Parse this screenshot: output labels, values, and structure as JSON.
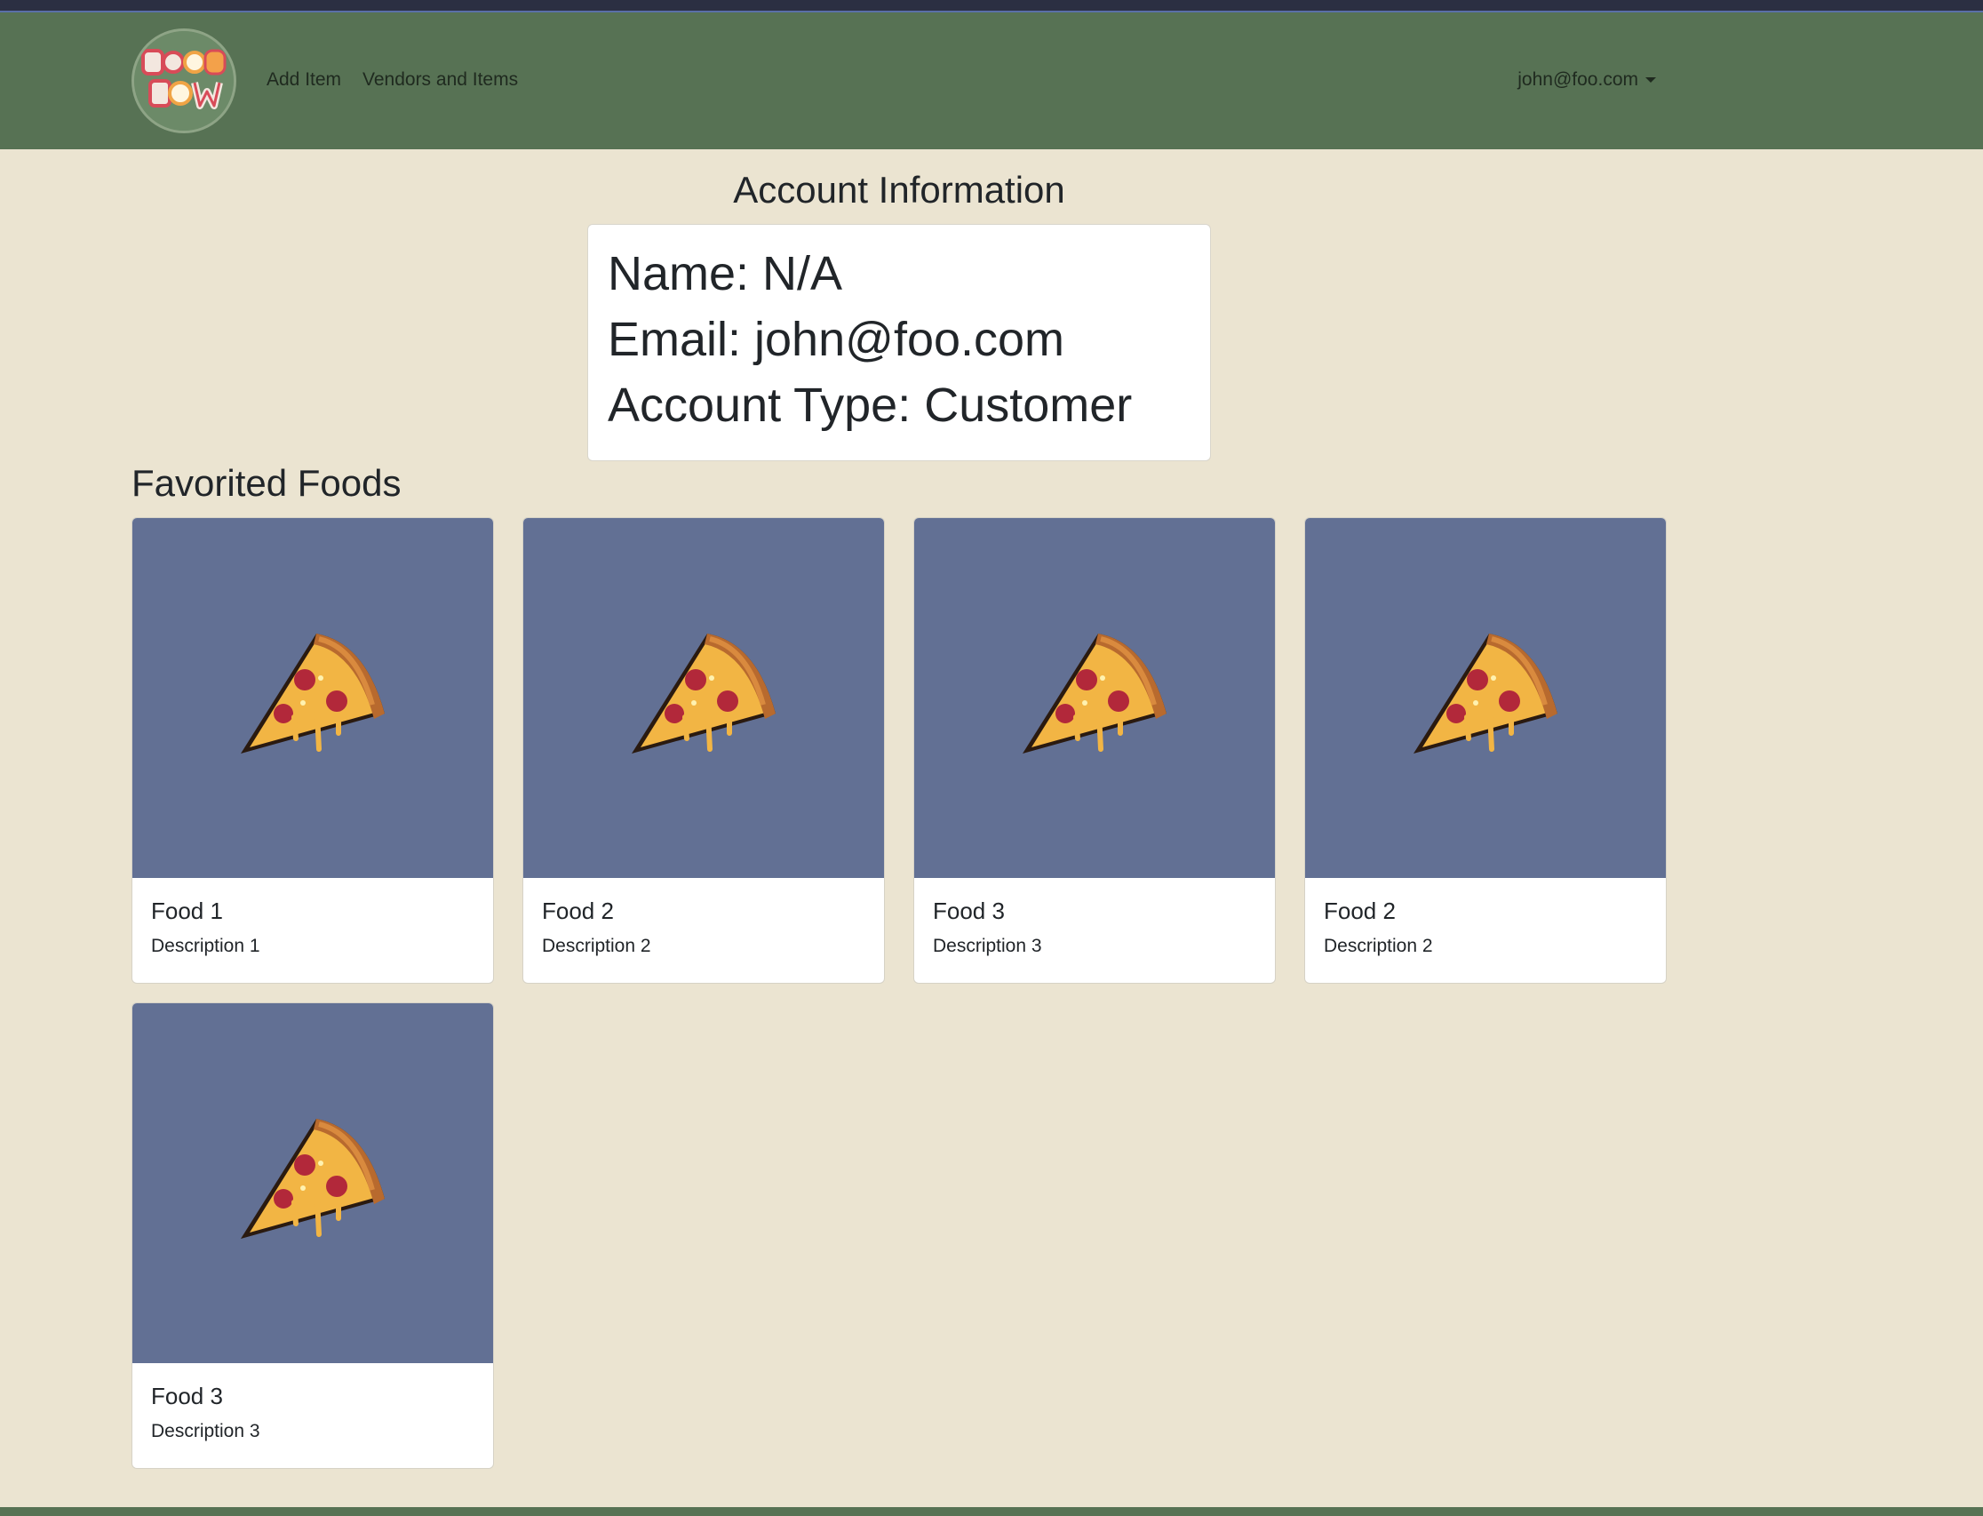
{
  "nav": {
    "logo_alt": "Food Now",
    "add_item": "Add Item",
    "vendors_items": "Vendors and Items",
    "user_email": "john@foo.com"
  },
  "account": {
    "title": "Account Information",
    "name_line": "Name: N/A",
    "email_line": "Email: john@foo.com",
    "type_line": "Account Type: Customer"
  },
  "favorites": {
    "title": "Favorited Foods",
    "items": [
      {
        "name": "Food 1",
        "description": "Description 1",
        "image_icon": "pizza-icon"
      },
      {
        "name": "Food 2",
        "description": "Description 2",
        "image_icon": "pizza-icon"
      },
      {
        "name": "Food 3",
        "description": "Description 3",
        "image_icon": "pizza-icon"
      },
      {
        "name": "Food 2",
        "description": "Description 2",
        "image_icon": "pizza-icon"
      },
      {
        "name": "Food 3",
        "description": "Description 3",
        "image_icon": "pizza-icon"
      }
    ]
  },
  "colors": {
    "navbar": "#577254",
    "page_bg": "#ebe4d1",
    "image_bg": "#627094"
  }
}
